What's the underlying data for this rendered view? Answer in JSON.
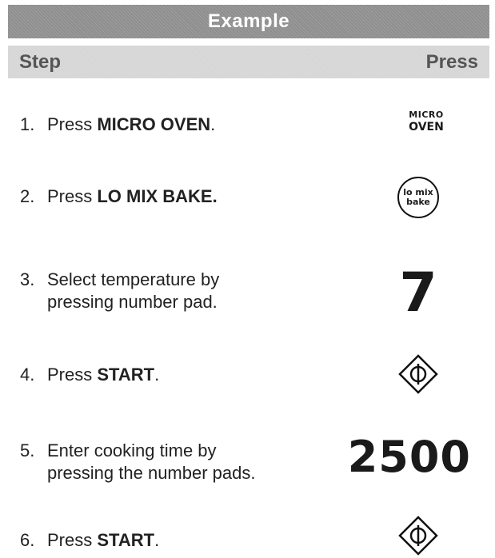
{
  "header": {
    "title": "Example",
    "col_step": "Step",
    "col_press": "Press"
  },
  "steps": [
    {
      "num": "1.",
      "pre": "Press ",
      "bold": "MICRO OVEN",
      "post": "."
    },
    {
      "num": "2.",
      "pre": "Press ",
      "bold": "LO MIX BAKE.",
      "post": ""
    },
    {
      "num": "3.",
      "line1": "Select temperature by",
      "line2": "pressing number pad."
    },
    {
      "num": "4.",
      "pre": "Press ",
      "bold": "START",
      "post": "."
    },
    {
      "num": "5.",
      "line1": "Enter cooking time by",
      "line2": "pressing the number pads."
    },
    {
      "num": "6.",
      "pre": "Press ",
      "bold": "START",
      "post": "."
    }
  ],
  "keys": {
    "micro_oven_line1": "MICRO",
    "micro_oven_line2": "OVEN",
    "lo_mix_line1": "lo mix",
    "lo_mix_line2": "bake",
    "temperature_digit": "7",
    "cook_time_digits": "2500",
    "start_icon": "start-diamond-icon"
  }
}
